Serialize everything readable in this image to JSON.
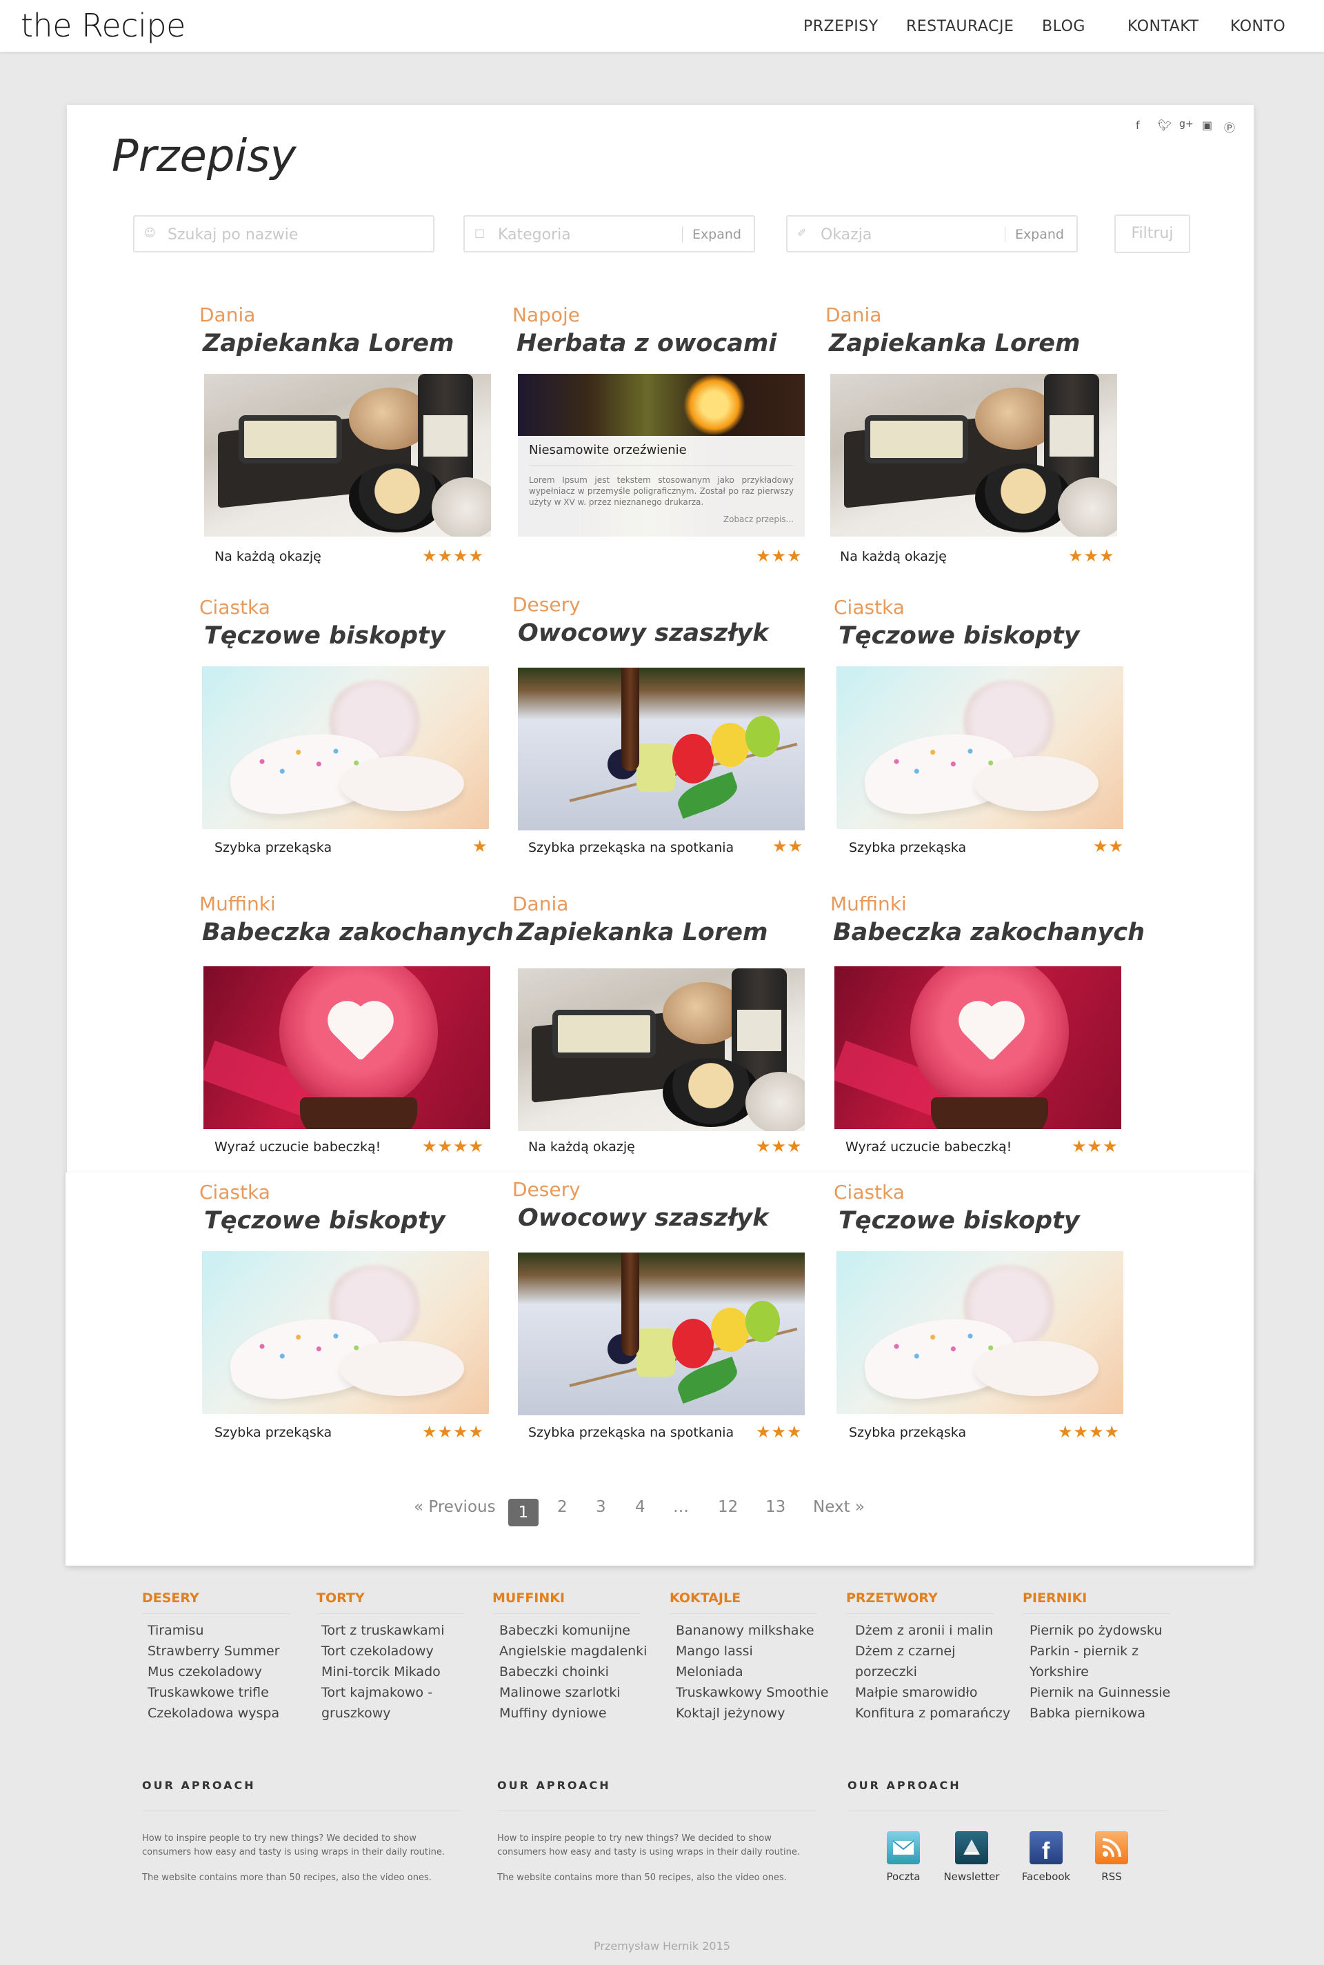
{
  "brand": "the Recipe",
  "nav": [
    "PRZEPISY",
    "RESTAURACJE",
    "BLOG",
    "KONTAKT",
    "KONTO"
  ],
  "page_title": "Przepisy",
  "social": [
    "f",
    "t",
    "g+",
    "ig",
    "p"
  ],
  "filters": {
    "search_placeholder": "Szukaj po nazwie",
    "category_placeholder": "Kategoria",
    "occasion_placeholder": "Okazja",
    "expand": "Expand",
    "button": "Filtruj"
  },
  "recipes": [
    {
      "category": "Dania",
      "title": "Zapiekanka Lorem",
      "caption": "Na każdą okazję",
      "rating": 4
    },
    {
      "category": "Napoje",
      "title": "Herbata z owocami",
      "caption": "",
      "rating": 3,
      "overlay": {
        "title": "Niesamowite orzeźwienie",
        "text": "Lorem Ipsum jest tekstem stosowanym jako przykładowy wypełniacz w przemyśle poligraficznym. Został po raz pierwszy użyty w XV w. przez nieznanego drukarza.",
        "more": "Zobacz przepis..."
      }
    },
    {
      "category": "Dania",
      "title": "Zapiekanka Lorem",
      "caption": "Na każdą okazję",
      "rating": 3
    },
    {
      "category": "Ciastka",
      "title": "Tęczowe biskopty",
      "caption": "Szybka przekąska",
      "rating": 1
    },
    {
      "category": "Desery",
      "title": "Owocowy szaszłyk",
      "caption": "Szybka przekąska na spotkania",
      "rating": 2
    },
    {
      "category": "Ciastka",
      "title": "Tęczowe biskopty",
      "caption": "Szybka przekąska",
      "rating": 2
    },
    {
      "category": "Muffinki",
      "title": "Babeczka zakochanych",
      "caption": "Wyraź uczucie babeczką!",
      "rating": 4
    },
    {
      "category": "Dania",
      "title": "Zapiekanka Lorem",
      "caption": "Na każdą okazję",
      "rating": 3
    },
    {
      "category": "Muffinki",
      "title": "Babeczka zakochanych",
      "caption": "Wyraź uczucie babeczką!",
      "rating": 3
    },
    {
      "category": "Ciastka",
      "title": "Tęczowe biskopty",
      "caption": "Szybka przekąska",
      "rating": 4
    },
    {
      "category": "Desery",
      "title": "Owocowy szaszłyk",
      "caption": "Szybka przekąska na spotkania",
      "rating": 3
    },
    {
      "category": "Ciastka",
      "title": "Tęczowe biskopty",
      "caption": "Szybka przekąska",
      "rating": 4
    }
  ],
  "pagination": {
    "previous": "« Previous",
    "pages": [
      "1",
      "2",
      "3",
      "4",
      "…",
      "12",
      "13"
    ],
    "current": "1",
    "next": "Next »"
  },
  "footer": {
    "columns": [
      {
        "heading": "DESERY",
        "items": [
          "Tiramisu",
          "Strawberry Summer",
          "Mus czekoladowy",
          "Truskawkowe trifle",
          "Czekoladowa wyspa"
        ]
      },
      {
        "heading": "TORTY",
        "items": [
          "Tort z truskawkami",
          "Tort czekoladowy",
          "Mini-torcik Mikado",
          "Tort kajmakowo -",
          "gruszkowy"
        ]
      },
      {
        "heading": "MUFFINKI",
        "items": [
          "Babeczki komunijne",
          "Angielskie magdalenki",
          "Babeczki choinki",
          "Malinowe szarlotki",
          "Muffiny dyniowe"
        ]
      },
      {
        "heading": "KOKTAJLE",
        "items": [
          "Bananowy milkshake",
          "Mango lassi",
          "Meloniada",
          "Truskawkowy Smoothie",
          "Koktajl jeżynowy"
        ]
      },
      {
        "heading": "PRZETWORY",
        "items": [
          "Dżem z aronii i malin",
          "Dżem z czarnej",
          "porzeczki",
          "Małpie smarowidło",
          "Konfitura z pomarańczy"
        ]
      },
      {
        "heading": "PIERNIKI",
        "items": [
          "Piernik po żydowsku",
          "Parkin - piernik z",
          "Yorkshire",
          "Piernik na Guinnessie",
          "Babka piernikowa"
        ]
      }
    ],
    "aproach": {
      "heading": "OUR APROACH",
      "line1": "How to inspire people to try new things? We decided to show",
      "line2": "consumers how easy and tasty is using wraps in their daily routine.",
      "line3": "The website contains more than 50 recipes, also the video ones."
    },
    "social_links": [
      "Poczta",
      "Newsletter",
      "Facebook",
      "RSS"
    ],
    "copyright": "Przemysław Hernik 2015"
  },
  "colors": {
    "accent": "#e89a5c",
    "star": "#e98a1e",
    "footer_heading": "#e0801e"
  }
}
